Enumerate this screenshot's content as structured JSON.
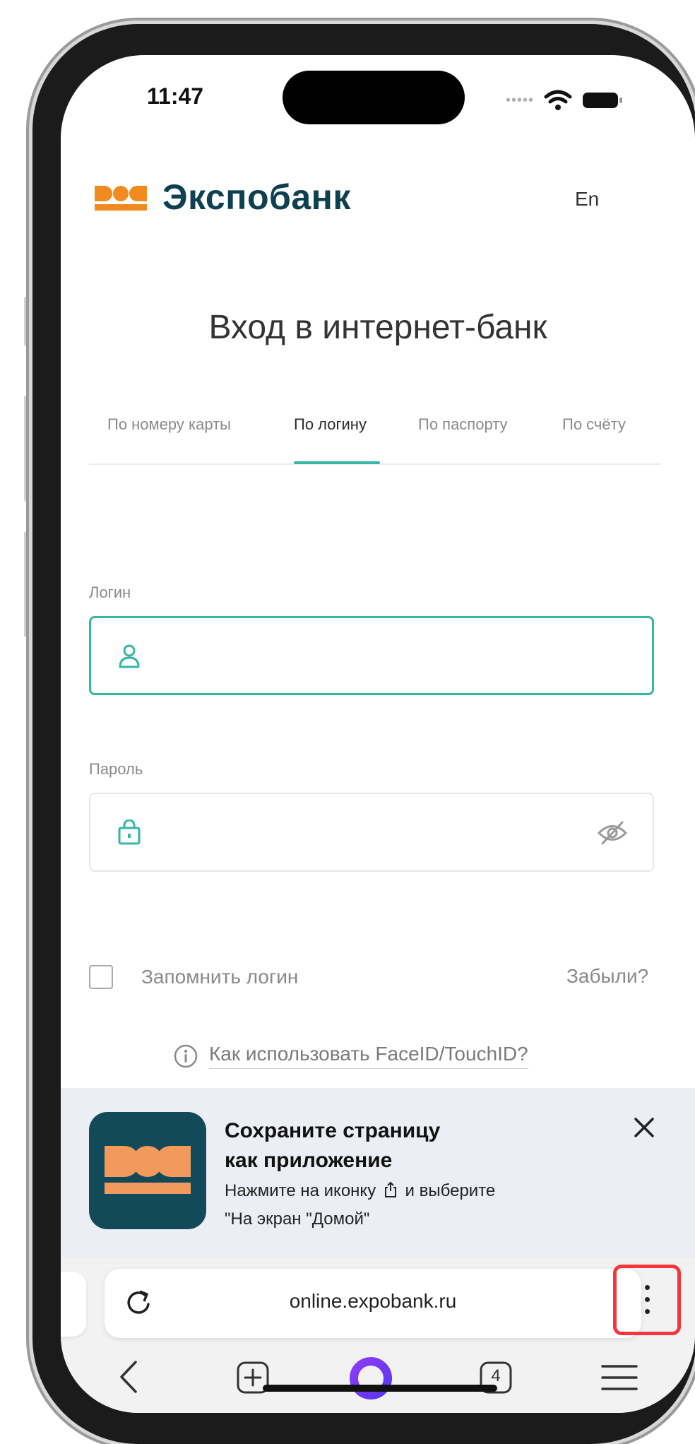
{
  "status_bar": {
    "time": "11:47"
  },
  "brand": {
    "name": "Экспобанк",
    "accent": "#f18a1f",
    "dark": "#0d4050"
  },
  "header": {
    "language_toggle": "En"
  },
  "page": {
    "title": "Вход в интернет-банк"
  },
  "tabs": [
    {
      "label": "По номеру карты",
      "active": false
    },
    {
      "label": "По логину",
      "active": true
    },
    {
      "label": "По паспорту",
      "active": false
    },
    {
      "label": "По счёту",
      "active": false
    }
  ],
  "form": {
    "login_label": "Логин",
    "login_value": "",
    "password_label": "Пароль",
    "password_value": "",
    "remember_label": "Запомнить логин",
    "forgot_link": "Забыли?",
    "faceid_link": "Как использовать FaceID/TouchID?"
  },
  "banner": {
    "title_line1": "Сохраните страницу",
    "title_line2": "как приложение",
    "sub_line1_before": "Нажмите на иконку",
    "sub_line1_after": "и выберите",
    "sub_line2": "\"На экран \"Домой\""
  },
  "browser": {
    "url": "online.expobank.ru",
    "tab_count": "4",
    "highlight_color": "#f2363c"
  },
  "colors": {
    "teal": "#36b6a6",
    "alice": "#6a3cf5"
  },
  "icons": [
    "user-icon",
    "lock-icon",
    "eye-off-icon",
    "info-icon",
    "share-icon",
    "close-icon",
    "reload-icon",
    "more-vertical-icon",
    "back-icon",
    "new-tab-icon",
    "alice-icon",
    "menu-icon"
  ]
}
